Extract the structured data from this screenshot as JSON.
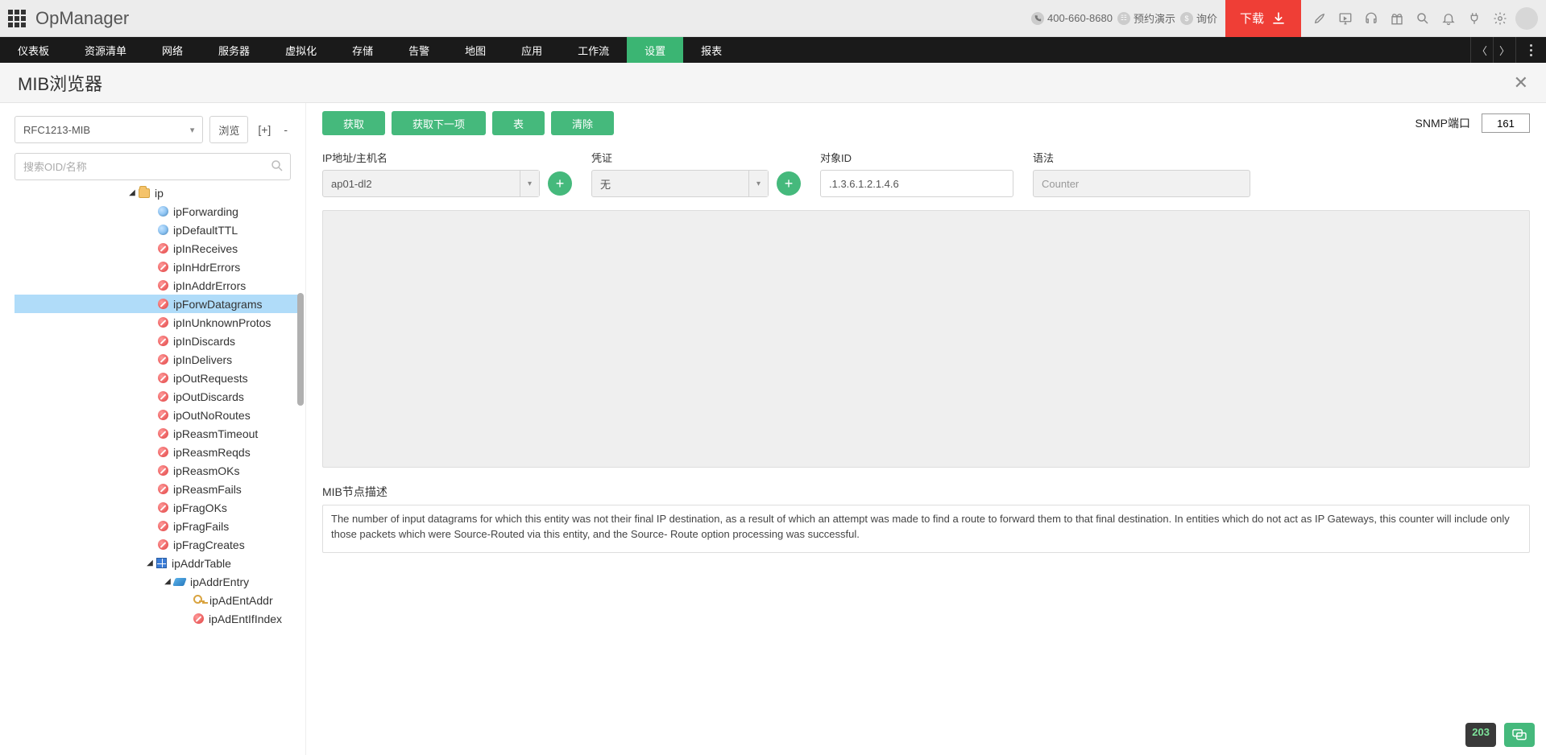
{
  "topbar": {
    "brand": "OpManager",
    "phone": "400-660-8680",
    "demo": "预约演示",
    "quote": "询价",
    "download": "下载"
  },
  "nav": {
    "items": [
      "仪表板",
      "资源清单",
      "网络",
      "服务器",
      "虚拟化",
      "存储",
      "告警",
      "地图",
      "应用",
      "工作流",
      "设置",
      "报表"
    ],
    "activeIndex": 10
  },
  "page": {
    "title": "MIB浏览器"
  },
  "sidebar": {
    "mibSelect": "RFC1213-MIB",
    "browse": "浏览",
    "plus": "[+]",
    "minus": "-",
    "searchPlaceholder": "搜索OID/名称",
    "tree": {
      "root": "ip",
      "selected": "ipForwDatagrams",
      "leaves": [
        {
          "label": "ipForwarding",
          "icon": "blue"
        },
        {
          "label": "ipDefaultTTL",
          "icon": "blue"
        },
        {
          "label": "ipInReceives",
          "icon": "nosign"
        },
        {
          "label": "ipInHdrErrors",
          "icon": "nosign"
        },
        {
          "label": "ipInAddrErrors",
          "icon": "nosign"
        },
        {
          "label": "ipForwDatagrams",
          "icon": "nosign"
        },
        {
          "label": "ipInUnknownProtos",
          "icon": "nosign"
        },
        {
          "label": "ipInDiscards",
          "icon": "nosign"
        },
        {
          "label": "ipInDelivers",
          "icon": "nosign"
        },
        {
          "label": "ipOutRequests",
          "icon": "nosign"
        },
        {
          "label": "ipOutDiscards",
          "icon": "nosign"
        },
        {
          "label": "ipOutNoRoutes",
          "icon": "nosign"
        },
        {
          "label": "ipReasmTimeout",
          "icon": "nosign"
        },
        {
          "label": "ipReasmReqds",
          "icon": "nosign"
        },
        {
          "label": "ipReasmOKs",
          "icon": "nosign"
        },
        {
          "label": "ipReasmFails",
          "icon": "nosign"
        },
        {
          "label": "ipFragOKs",
          "icon": "nosign"
        },
        {
          "label": "ipFragFails",
          "icon": "nosign"
        },
        {
          "label": "ipFragCreates",
          "icon": "nosign"
        }
      ],
      "subtable": {
        "label": "ipAddrTable",
        "entry": "ipAddrEntry",
        "children": [
          "ipAdEntAddr",
          "ipAdEntIfIndex"
        ]
      }
    }
  },
  "actions": {
    "get": "获取",
    "getNext": "获取下一项",
    "table": "表",
    "clear": "清除",
    "snmpPortLabel": "SNMP端口",
    "snmpPortValue": "161"
  },
  "fields": {
    "host": {
      "label": "IP地址/主机名",
      "value": "ap01-dl2"
    },
    "cred": {
      "label": "凭证",
      "value": "无"
    },
    "oid": {
      "label": "对象ID",
      "value": ".1.3.6.1.2.1.4.6"
    },
    "syntax": {
      "label": "语法",
      "value": "Counter"
    }
  },
  "desc": {
    "label": "MIB节点描述",
    "text": "The number of input datagrams for which this entity was not their final IP destination, as a result of which an attempt was made to find a route to forward them to that final destination. In entities which do not act as IP Gateways, this counter will include only those packets which were Source-Routed via this entity, and the Source- Route option processing was successful."
  },
  "floating": {
    "count": "203"
  }
}
